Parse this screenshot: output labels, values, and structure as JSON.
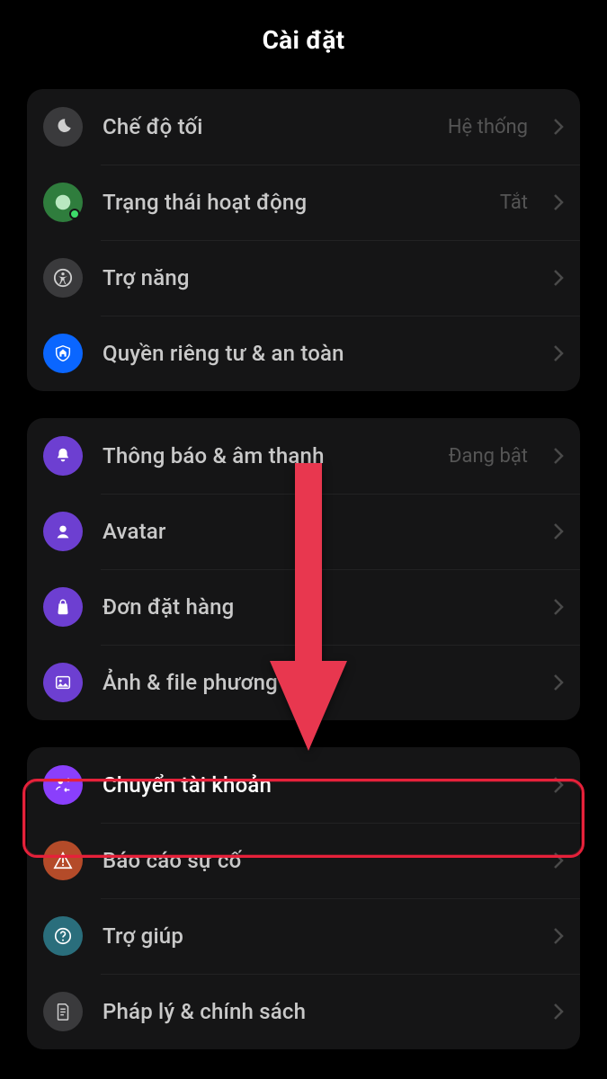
{
  "title": "Cài đặt",
  "section1": [
    {
      "icon": "moon",
      "bg": "bg-gray",
      "label": "Chế độ tối",
      "value": "Hệ thống"
    },
    {
      "icon": "status",
      "bg": "bg-green",
      "label": "Trạng thái hoạt động",
      "value": "Tắt"
    },
    {
      "icon": "accessibility",
      "bg": "bg-gray",
      "label": "Trợ năng",
      "value": ""
    },
    {
      "icon": "shield-house",
      "bg": "bg-blue",
      "label": "Quyền riêng tư & an toàn",
      "value": ""
    }
  ],
  "section2": [
    {
      "icon": "bell",
      "bg": "bg-purple",
      "label": "Thông báo & âm thanh",
      "value": "Đang bật"
    },
    {
      "icon": "avatar",
      "bg": "bg-purple",
      "label": "Avatar",
      "value": ""
    },
    {
      "icon": "bag",
      "bg": "bg-purple",
      "label": "Đơn đặt hàng",
      "value": ""
    },
    {
      "icon": "photo",
      "bg": "bg-purple",
      "label": "Ảnh & file phương tiện",
      "value": ""
    }
  ],
  "section3": [
    {
      "icon": "switch-account",
      "bg": "bg-pbright",
      "label": "Chuyển tài khoản",
      "value": "",
      "active": true
    },
    {
      "icon": "warning",
      "bg": "bg-orange",
      "label": "Báo cáo sự cố",
      "value": ""
    },
    {
      "icon": "help",
      "bg": "bg-teal",
      "label": "Trợ giúp",
      "value": ""
    },
    {
      "icon": "doc",
      "bg": "bg-gray",
      "label": "Pháp lý & chính sách",
      "value": ""
    }
  ],
  "annotation": {
    "arrow_color": "#e8374f",
    "highlight_color": "#e6213a"
  }
}
